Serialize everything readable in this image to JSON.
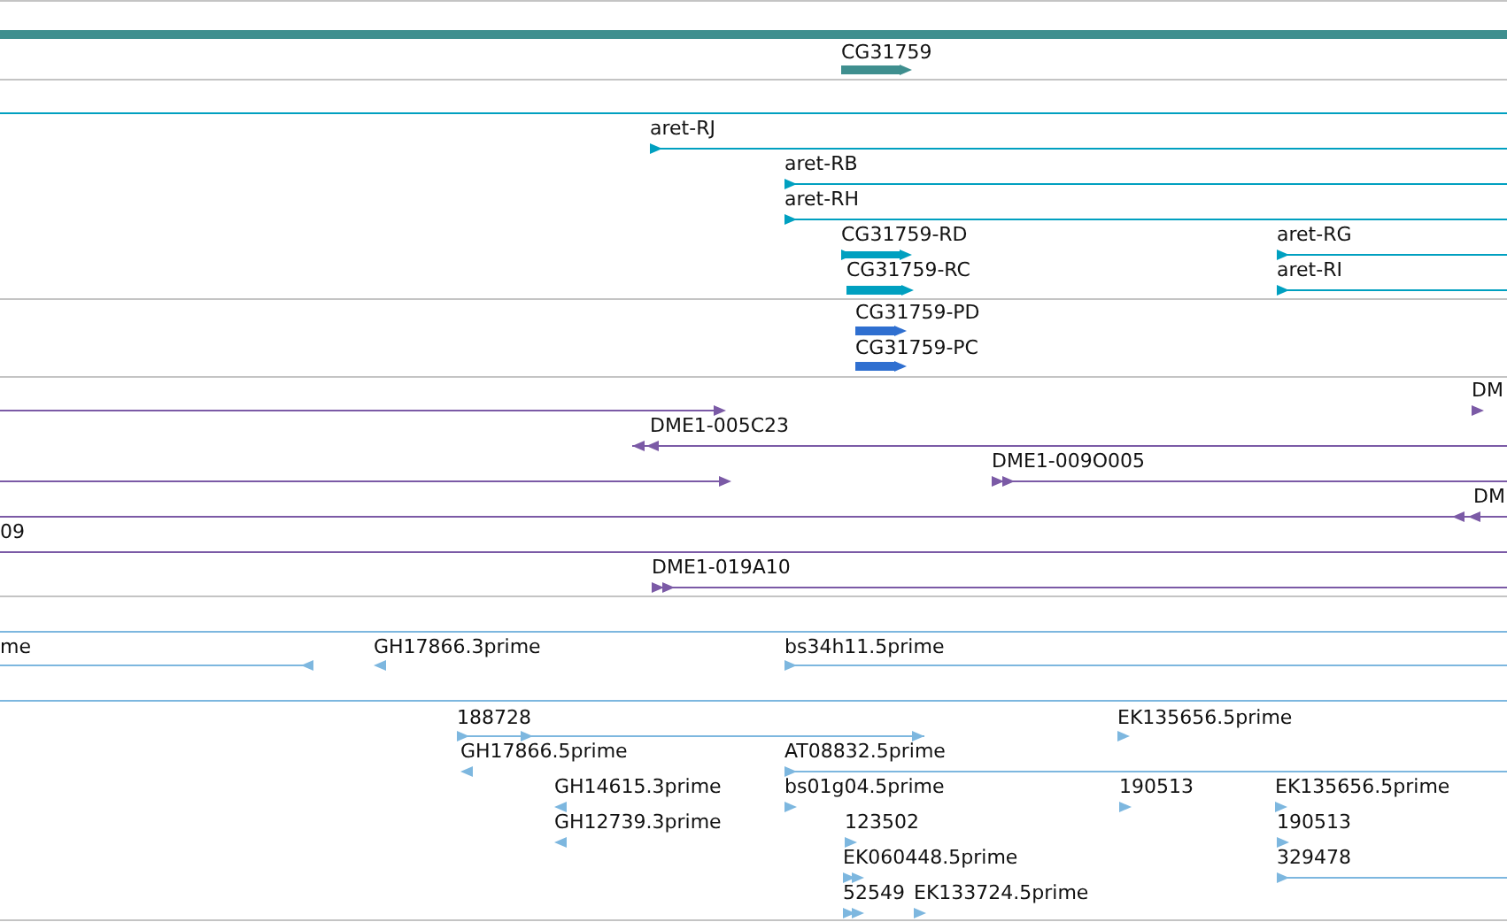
{
  "tracks": [
    {
      "color": "#3f8f8f",
      "features": [
        {
          "arrowed": false
        },
        {
          "label": "CG31759",
          "arrowed": true,
          "reverse": false
        }
      ]
    },
    {
      "color": "#00a0c0",
      "features": [
        {
          "arrowed": false
        },
        {
          "label": "aret-RJ",
          "arrowed": true,
          "reverse": false
        },
        {
          "label": "aret-RB",
          "arrowed": true,
          "reverse": false
        },
        {
          "label": "aret-RH",
          "arrowed": true,
          "reverse": false
        },
        {
          "label": "CG31759-RD",
          "arrowed": true,
          "reverse": false
        },
        {
          "label": "aret-RG",
          "arrowed": true,
          "reverse": false
        },
        {
          "label": "CG31759-RC",
          "arrowed": true,
          "reverse": false
        },
        {
          "label": "aret-RI",
          "arrowed": true,
          "reverse": false
        }
      ]
    },
    {
      "color": "#2f6fd0",
      "features": [
        {
          "label": "CG31759-PD",
          "arrowed": true,
          "reverse": false
        },
        {
          "label": "CG31759-PC",
          "arrowed": true,
          "reverse": false
        }
      ]
    },
    {
      "color": "#7b5aa6",
      "features": [
        {
          "arrowed": true,
          "reverse": false
        },
        {
          "label": "DM",
          "arrowed": true,
          "reverse": false
        },
        {
          "label": "DME1-005C23",
          "arrowed": true,
          "reverse": true
        },
        {
          "arrowed": true,
          "reverse": false
        },
        {
          "label": "DME1-009O005",
          "arrowed": true,
          "reverse": false
        },
        {
          "label": "DM",
          "arrowed": true,
          "reverse": true
        },
        {
          "label": "09",
          "arrowed": false
        },
        {
          "label": "DME1-019A10",
          "arrowed": true,
          "reverse": false
        }
      ]
    },
    {
      "color": "#7db7df",
      "features": [
        {
          "arrowed": false
        },
        {
          "label": "me",
          "arrowed": true,
          "reverse": true
        },
        {
          "label": "GH17866.3prime",
          "arrowed": true,
          "reverse": true
        },
        {
          "label": "bs34h11.5prime",
          "arrowed": true,
          "reverse": false
        }
      ]
    },
    {
      "color": "#7db7df",
      "features": [
        {
          "arrowed": false
        },
        {
          "label": "188728",
          "arrowed": true,
          "reverse": false
        },
        {
          "label": "EK135656.5prime",
          "arrowed": true,
          "reverse": false
        },
        {
          "label": "GH17866.5prime",
          "arrowed": true,
          "reverse": true
        },
        {
          "label": "AT08832.5prime",
          "arrowed": true,
          "reverse": false
        },
        {
          "label": "GH14615.3prime",
          "arrowed": true,
          "reverse": true
        },
        {
          "label": "bs01g04.5prime",
          "arrowed": true,
          "reverse": false
        },
        {
          "label": "190513",
          "arrowed": true,
          "reverse": false
        },
        {
          "label": "EK135656.5prime",
          "arrowed": true,
          "reverse": false
        },
        {
          "label": "GH12739.3prime",
          "arrowed": true,
          "reverse": true
        },
        {
          "label": "123502",
          "arrowed": true,
          "reverse": false
        },
        {
          "label": "190513",
          "arrowed": true,
          "reverse": false
        },
        {
          "label": "EK060448.5prime",
          "arrowed": true,
          "reverse": false
        },
        {
          "label": "329478",
          "arrowed": true,
          "reverse": false
        },
        {
          "label": "52549",
          "arrowed": true,
          "reverse": false
        },
        {
          "label": "EK133724.5prime",
          "arrowed": true,
          "reverse": false
        }
      ]
    }
  ]
}
